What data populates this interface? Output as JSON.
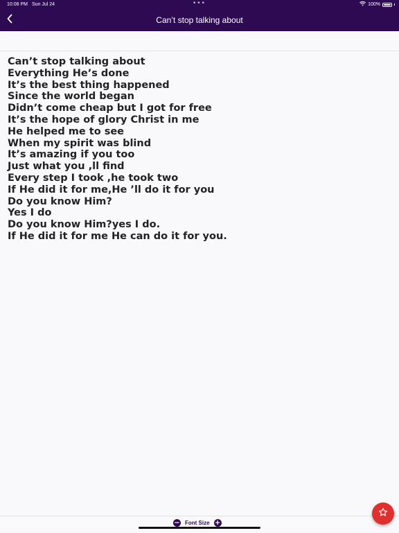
{
  "status_bar": {
    "time": "10:08 PM",
    "date": "Sun Jul 24",
    "dots": "•••",
    "battery": "100%"
  },
  "header": {
    "title": "Can’t stop talking about"
  },
  "lyrics": [
    "Can’t stop talking about",
    "Everything He’s done",
    "It’s the best thing happened",
    "Since the world began",
    "Didn’t come cheap but I got for free",
    "It’s the hope of glory Christ in me",
    "He helped me to see",
    "When my spirit was blind",
    "It’s amazing if you too",
    "Just what you ,ll find",
    "Every step I took ,he took two",
    "If He did it for me,He ’ll do it for you",
    "Do you know Him?",
    "Yes I do",
    "Do you know Him?yes I do.",
    "If He did it for me He can do it for you."
  ],
  "footer": {
    "font_size_label": "Font Size",
    "decrease_symbol": "−",
    "increase_symbol": "+"
  },
  "colors": {
    "header_bg": "#2e0a52",
    "fab_bg": "#e02f2f"
  },
  "icons": {
    "back": "chevron-left-icon",
    "favorite": "star-outline-icon",
    "wifi": "wifi-icon",
    "battery": "battery-icon"
  }
}
